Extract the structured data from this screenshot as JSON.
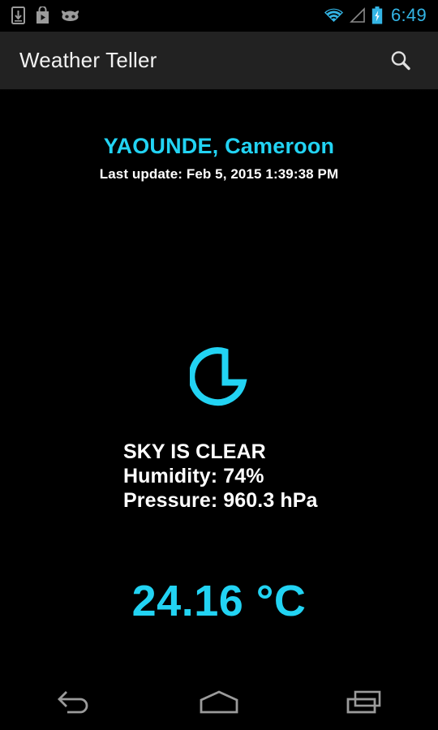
{
  "status_bar": {
    "icons_left": [
      {
        "name": "download-manager-icon",
        "label": "Download"
      },
      {
        "name": "play-store-icon",
        "label": "Play Store"
      },
      {
        "name": "android-head-icon",
        "label": "Android"
      }
    ],
    "icons_right": [
      {
        "name": "wifi-icon",
        "label": "Wi-Fi"
      },
      {
        "name": "cell-signal-icon",
        "label": "Cellular signal"
      },
      {
        "name": "battery-charging-icon",
        "label": "Battery charging"
      }
    ],
    "time": "6:49",
    "accent_color": "#33B5E5"
  },
  "app_bar": {
    "title": "Weather Teller",
    "search_icon": "search-icon",
    "background_color": "#222222"
  },
  "weather": {
    "city": "YAOUNDE, Cameroon",
    "last_update": "Last update: Feb 5, 2015 1:39:38 PM",
    "icon": "moon-clear-icon",
    "sky": "SKY IS CLEAR",
    "humidity": "Humidity: 74%",
    "pressure": "Pressure: 960.3 hPa",
    "temperature": "24.16 °C",
    "accent_color": "#22D3F3",
    "text_color": "#FFFFFF",
    "background_color": "#000000"
  },
  "nav_bar": {
    "buttons": [
      {
        "name": "nav-back-button",
        "label": "Back"
      },
      {
        "name": "nav-home-button",
        "label": "Home"
      },
      {
        "name": "nav-recents-button",
        "label": "Recent apps"
      }
    ],
    "icon_color": "#9B9B9B"
  }
}
